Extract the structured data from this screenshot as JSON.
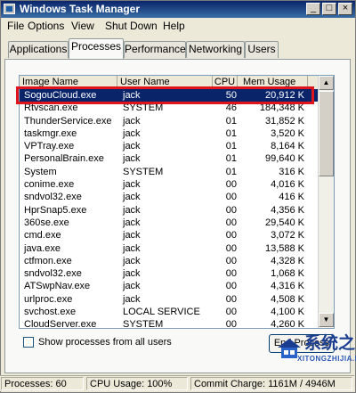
{
  "window": {
    "title": "Windows Task Manager",
    "controls": {
      "minimize": "_",
      "maximize": "□",
      "close": "×"
    }
  },
  "menu": [
    "File",
    "Options",
    "View",
    "Shut Down",
    "Help"
  ],
  "tabs": [
    "Applications",
    "Processes",
    "Performance",
    "Networking",
    "Users"
  ],
  "active_tab": "Processes",
  "columns": [
    "Image Name",
    "User Name",
    "CPU",
    "Mem Usage"
  ],
  "processes": [
    {
      "image": "SogouCloud.exe",
      "user": "jack",
      "cpu": "50",
      "mem": "20,912 K"
    },
    {
      "image": "Rtvscan.exe",
      "user": "SYSTEM",
      "cpu": "46",
      "mem": "184,348 K"
    },
    {
      "image": "ThunderService.exe",
      "user": "jack",
      "cpu": "01",
      "mem": "31,852 K"
    },
    {
      "image": "taskmgr.exe",
      "user": "jack",
      "cpu": "01",
      "mem": "3,520 K"
    },
    {
      "image": "VPTray.exe",
      "user": "jack",
      "cpu": "01",
      "mem": "8,164 K"
    },
    {
      "image": "PersonalBrain.exe",
      "user": "jack",
      "cpu": "01",
      "mem": "99,640 K"
    },
    {
      "image": "System",
      "user": "SYSTEM",
      "cpu": "01",
      "mem": "316 K"
    },
    {
      "image": "conime.exe",
      "user": "jack",
      "cpu": "00",
      "mem": "4,016 K"
    },
    {
      "image": "sndvol32.exe",
      "user": "jack",
      "cpu": "00",
      "mem": "416 K"
    },
    {
      "image": "HprSnap5.exe",
      "user": "jack",
      "cpu": "00",
      "mem": "4,356 K"
    },
    {
      "image": "360se.exe",
      "user": "jack",
      "cpu": "00",
      "mem": "29,540 K"
    },
    {
      "image": "cmd.exe",
      "user": "jack",
      "cpu": "00",
      "mem": "3,072 K"
    },
    {
      "image": "java.exe",
      "user": "jack",
      "cpu": "00",
      "mem": "13,588 K"
    },
    {
      "image": "ctfmon.exe",
      "user": "jack",
      "cpu": "00",
      "mem": "4,328 K"
    },
    {
      "image": "sndvol32.exe",
      "user": "jack",
      "cpu": "00",
      "mem": "1,068 K"
    },
    {
      "image": "ATSwpNav.exe",
      "user": "jack",
      "cpu": "00",
      "mem": "4,316 K"
    },
    {
      "image": "urlproc.exe",
      "user": "jack",
      "cpu": "00",
      "mem": "4,508 K"
    },
    {
      "image": "svchost.exe",
      "user": "LOCAL SERVICE",
      "cpu": "00",
      "mem": "4,100 K"
    },
    {
      "image": "CloudServer.exe",
      "user": "SYSTEM",
      "cpu": "00",
      "mem": "4,260 K"
    }
  ],
  "selected_row": 0,
  "show_all_label": "Show processes from all users",
  "end_process_label": "End Process",
  "status": {
    "processes": "Processes: 60",
    "cpu": "CPU Usage: 100%",
    "commit": "Commit Charge: 1161M / 4946M"
  },
  "watermark": {
    "text": "系统之家",
    "url": "XITONGZHIJIA.NET"
  },
  "colors": {
    "title_bar": "#0a246a",
    "selection": "#0a246a",
    "highlight_box": "#e0141c"
  }
}
